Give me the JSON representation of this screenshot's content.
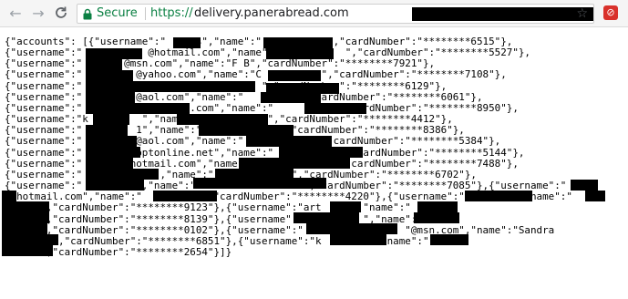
{
  "browser": {
    "secure_label": "Secure",
    "url_scheme": "https://",
    "url_host": "delivery.panerabread.com",
    "star_icon": "star-icon",
    "extension_icon": "extension-icon"
  },
  "page": {
    "json_lines": [
      "{\"accounts\": [{\"username\":\"     s\",\"name\":\"           \",\"cardNumber\":\"********6515\"},",
      "{\"username\":\"           @hotmail.com\",\"name\":\"           \",\"cardNumber\":\"********5527\"},",
      "{\"username\":\"       @msn.com\",\"name\":\"F B\",\"cardNumber\":\"********7921\"},",
      "{\"username\":\"         @yahoo.com\",\"name\":\"C          \",\"cardNumber\":\"********7108\"},",
      "{\"username\":\"                              \",\"cardNumber\":\"********6129\"},",
      "{\"username\":\"         @aol.com\",\"name\":\"         \",\"cardNumber\":\"********6061\"},",
      "{\"username\":\"             yahoo.com\",\"name\":\"          \",\"cardNumber\":\"********8950\"},",
      "{\"username\":\"k         \",\"name\":\"           \",\"cardNumber\":\"********4412\"},",
      "{\"username\":\"         1\",\"name\":\"             \",\"cardNumber\":\"********8386\"},",
      "{\"username\":\"         @aol.com\",\"name\":\"            \",\"cardNumber\":\"********5384\"},",
      "{\"username\":\"         optonline.net\",\"name\":\"           \",\"cardNumber\":\"********5144\"},",
      "{\"username\":\"        hotmail.com\",\"name\":\"             \",\"cardNumber\":\"********7488\"},",
      "{\"username\":\"            \",\"name\":\"             \",\"cardNumber\":\"********6702\"},",
      "{\"username\":\"         \",\"name\":\"                  \",\"cardNumber\":\"********7085\"},{\"username\":\"    ",
      "  hotmail.com\",\"name\":\"          \",\"cardNumber\":\"********4220\"},{\"username\":\"        \",\"name\":\"  ",
      "      \",\"cardNumber\":\"********9123\"},{\"username\":\"art     \",\"name\":\"       ",
      "      \",\"cardNumber\":\"********8139\"},{\"username\":\"          \",\"name\":\"       ",
      "      \",\"cardNumber\":\"********0102\"},{\"username\":\"                 \"@msn.com\",\"name\":\"Sandra",
      "        \",\"cardNumber\":\"********6851\"},{\"username\":\"k          \"name\":\"       ",
      "      \",\"cardNumber\":\"********2654\"}]}"
    ]
  }
}
